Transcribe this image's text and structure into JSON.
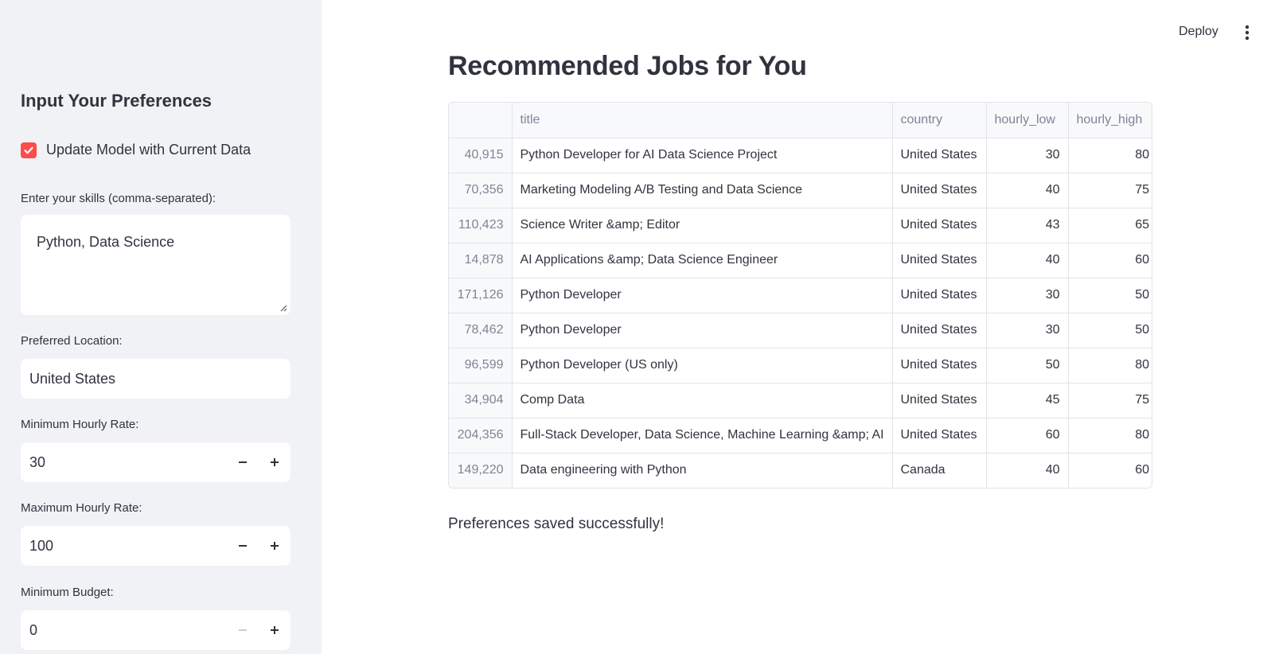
{
  "sidebar": {
    "heading": "Input Your Preferences",
    "update_model": {
      "label": "Update Model with Current Data",
      "checked": true
    },
    "skills": {
      "label": "Enter your skills (comma-separated):",
      "value": "Python, Data Science"
    },
    "location": {
      "label": "Preferred Location:",
      "value": "United States"
    },
    "min_rate": {
      "label": "Minimum Hourly Rate:",
      "value": "30"
    },
    "max_rate": {
      "label": "Maximum Hourly Rate:",
      "value": "100"
    },
    "min_budget": {
      "label": "Minimum Budget:",
      "value": "0"
    }
  },
  "toolbar": {
    "deploy_label": "Deploy"
  },
  "main": {
    "title": "Recommended Jobs for You",
    "table": {
      "columns": [
        "",
        "title",
        "country",
        "hourly_low",
        "hourly_high"
      ],
      "rows": [
        [
          "40,915",
          "Python Developer for AI Data Science Project",
          "United States",
          "30",
          "80"
        ],
        [
          "70,356",
          "Marketing Modeling A/B Testing and Data Science",
          "United States",
          "40",
          "75"
        ],
        [
          "110,423",
          "Science Writer &amp; Editor",
          "United States",
          "43",
          "65"
        ],
        [
          "14,878",
          "AI Applications &amp; Data Science Engineer",
          "United States",
          "40",
          "60"
        ],
        [
          "171,126",
          "Python Developer",
          "United States",
          "30",
          "50"
        ],
        [
          "78,462",
          "Python Developer",
          "United States",
          "30",
          "50"
        ],
        [
          "96,599",
          "Python Developer (US only)",
          "United States",
          "50",
          "80"
        ],
        [
          "34,904",
          "Comp Data",
          "United States",
          "45",
          "75"
        ],
        [
          "204,356",
          "Full-Stack Developer, Data Science, Machine Learning &amp; AI",
          "United States",
          "60",
          "80"
        ],
        [
          "149,220",
          "Data engineering with Python",
          "Canada",
          "40",
          "60"
        ]
      ]
    },
    "success_message": "Preferences saved successfully!"
  },
  "colors": {
    "accent": "#ff4b4b",
    "sidebar_bg": "#f0f2f6",
    "text": "#31333f",
    "muted": "#808495"
  }
}
